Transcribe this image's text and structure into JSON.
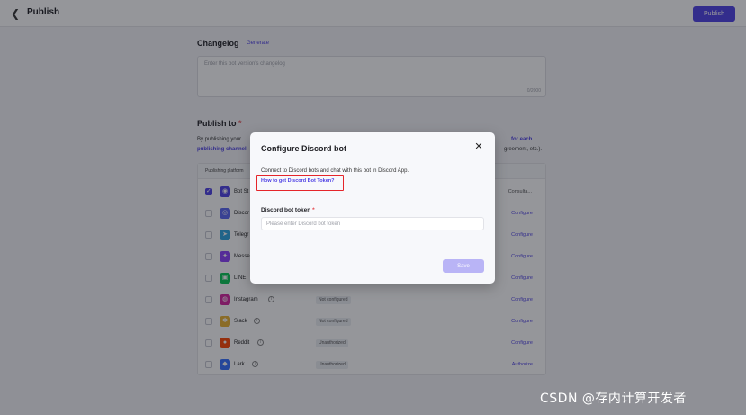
{
  "header": {
    "title": "Publish",
    "publish_label": "Publish"
  },
  "changelog": {
    "title": "Changelog",
    "generate_label": "Generate",
    "placeholder": "Enter this bot version's changelog",
    "char_count": "0/2000"
  },
  "publish_to": {
    "title": "Publish to",
    "required_mark": "*",
    "desc_line1_left": "By publishing your",
    "desc_line1_right": "for each",
    "desc_line2_left": "publishing channel",
    "desc_line2_right": "greement, etc.).",
    "table_header": "Publishing platform",
    "rows": [
      {
        "name": "Bot St",
        "icon_color": "#4e40e5",
        "icon_glyph": "◉",
        "checked": true,
        "status": "",
        "action": "Consulta...",
        "info": false
      },
      {
        "name": "Discor",
        "icon_color": "#5865f2",
        "icon_glyph": "◎",
        "checked": false,
        "status": "",
        "action": "Configure",
        "info": false
      },
      {
        "name": "Telegr",
        "icon_color": "#2aa4e0",
        "icon_glyph": "➤",
        "checked": false,
        "status": "",
        "action": "Configure",
        "info": false
      },
      {
        "name": "Messe",
        "icon_color": "#8a3ffc",
        "icon_glyph": "✦",
        "checked": false,
        "status": "",
        "action": "Configure",
        "info": false
      },
      {
        "name": "LINE",
        "icon_color": "#06c755",
        "icon_glyph": "▣",
        "checked": false,
        "status": "",
        "action": "Configure",
        "info": false
      },
      {
        "name": "Instagram",
        "icon_color": "#d6249f",
        "icon_glyph": "◍",
        "checked": false,
        "status": "Not configured",
        "action": "Configure",
        "info": true
      },
      {
        "name": "Slack",
        "icon_color": "#ecb22e",
        "icon_glyph": "✱",
        "checked": false,
        "status": "Not configured",
        "action": "Configure",
        "info": true
      },
      {
        "name": "Reddit",
        "icon_color": "#ff4500",
        "icon_glyph": "●",
        "checked": false,
        "status": "Unauthorized",
        "action": "Configure",
        "info": true
      },
      {
        "name": "Lark",
        "icon_color": "#3370ff",
        "icon_glyph": "◆",
        "checked": false,
        "status": "Unauthorized",
        "action": "Authorize",
        "info": true
      }
    ]
  },
  "modal": {
    "title": "Configure Discord bot",
    "description": "Connect to Discord bots and chat with this bot in Discord App.",
    "token_link": "How to get Discord Bot Token?",
    "field_label": "Discord bot token",
    "required_mark": "*",
    "input_placeholder": "Please enter Discord bot token",
    "input_value": "",
    "save_label": "Save"
  },
  "watermark": "CSDN @存内计算开发者",
  "colors": {
    "accent": "#4e40e5",
    "disabled_accent": "#b9b4f6",
    "highlight": "#e5252a"
  }
}
